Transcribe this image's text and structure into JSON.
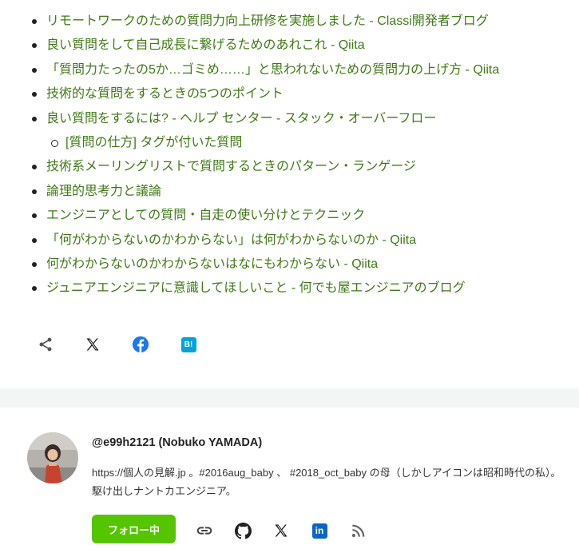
{
  "links": [
    {
      "text": "リモートワークのための質問力向上研修を実施しました - Classi開発者ブログ",
      "level": 1
    },
    {
      "text": "良い質問をして自己成長に繋げるためのあれこれ - Qiita",
      "level": 1
    },
    {
      "text": "「質問力たったの5か…ゴミめ……」と思われないための質問力の上げ方 - Qiita",
      "level": 1
    },
    {
      "text": "技術的な質問をするときの5つのポイント",
      "level": 1
    },
    {
      "text": "良い質問をするには? - ヘルプ センター - スタック・オーバーフロー",
      "level": 1
    },
    {
      "text": "[質問の仕方] タグが付いた質問",
      "level": 2
    },
    {
      "text": "技術系メーリングリストで質問するときのパターン・ランゲージ",
      "level": 1
    },
    {
      "text": "論理的思考力と議論",
      "level": 1
    },
    {
      "text": "エンジニアとしての質問・自走の使い分けとテクニック",
      "level": 1
    },
    {
      "text": "「何がわからないのかわからない」は何がわからないのか - Qiita",
      "level": 1
    },
    {
      "text": "何がわからないのかわからないはなにもわからない - Qiita",
      "level": 1
    },
    {
      "text": "ジュニアエンジニアに意識してほしいこと - 何でも屋エンジニアのブログ",
      "level": 1
    }
  ],
  "share": {
    "items": [
      {
        "name": "share-icon"
      },
      {
        "name": "x-icon"
      },
      {
        "name": "facebook-icon"
      },
      {
        "name": "hatena-bookmark-icon",
        "label": "B!"
      }
    ]
  },
  "author": {
    "name": "@e99h2121 (Nobuko YAMADA)",
    "bio": "https://個人の見解.jp 。#2016aug_baby 、 #2018_oct_baby の母（しかしアイコンは昭和時代の私）。駆け出しナントカエンジニア。",
    "follow_label": "フォロー中",
    "social": [
      {
        "name": "link-icon"
      },
      {
        "name": "github-icon"
      },
      {
        "name": "x-icon"
      },
      {
        "name": "linkedin-icon",
        "label": "in"
      },
      {
        "name": "rss-icon"
      }
    ]
  },
  "colors": {
    "link": "#3f7a16",
    "follow_button": "#55c500",
    "facebook": "#1877f2",
    "hatena": "#00a4de",
    "linkedin": "#0a66c2",
    "band": "#f4f5f5"
  }
}
